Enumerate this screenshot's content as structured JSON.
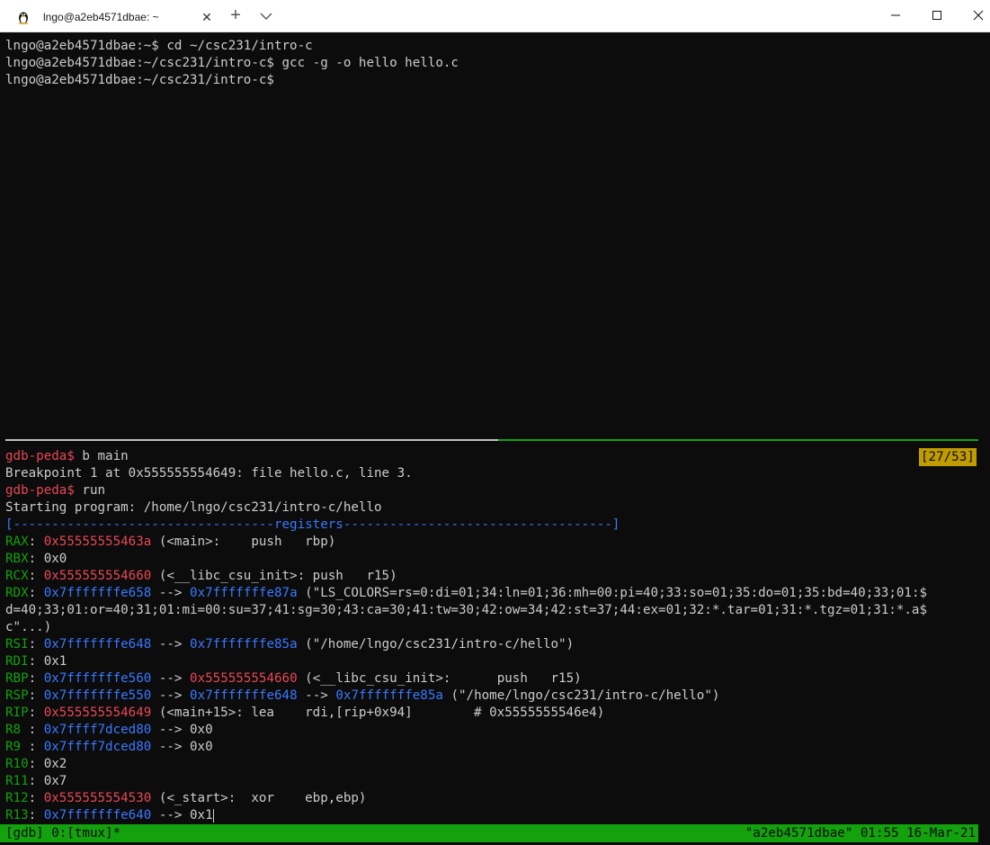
{
  "window": {
    "tab_title": "lngo@a2eb4571dbae: ~",
    "tab_icon": "linux-penguin-icon",
    "new_tab_symbol": "+",
    "close_symbol": "✕",
    "minimize_symbol": "—",
    "maximize_symbol": "☐",
    "window_close_symbol": "✕"
  },
  "top_pane": {
    "lines": [
      "lngo@a2eb4571dbae:~$ cd ~/csc231/intro-c",
      "lngo@a2eb4571dbae:~/csc231/intro-c$ gcc -g -o hello hello.c",
      "lngo@a2eb4571dbae:~/csc231/intro-c$"
    ]
  },
  "bottom_pane": {
    "position_indicator": "[27/53]",
    "prompt": "gdb-peda$",
    "cmd1": " b main",
    "breakpoint_msg": "Breakpoint 1 at 0x555555554649: file hello.c, line 3.",
    "cmd2": " run",
    "starting_msg": "Starting program: /home/lngo/csc231/intro-c/hello",
    "registers_header": "[----------------------------------registers-----------------------------------]",
    "registers": {
      "rax": {
        "name": "RAX",
        "value": "0x55555555463a",
        "rest": " (<main>:    push   rbp)"
      },
      "rbx": {
        "name": "RBX",
        "rest": " 0x0"
      },
      "rcx": {
        "name": "RCX",
        "value": "0x555555554660",
        "rest": " (<__libc_csu_init>: push   r15)"
      },
      "rdx": {
        "name": "RDX",
        "value": "0x7fffffffe658",
        "arrow": " --> ",
        "value2": "0x7fffffffe87a",
        "rest": " (\"LS_COLORS=rs=0:di=01;34:ln=01;36:mh=00:pi=40;33:so=01;35:do=01;35:bd=40;33;01:$",
        "wrap1": "d=40;33;01:or=40;31;01:mi=00:su=37;41:sg=30;43:ca=30;41:tw=30;42:ow=34;42:st=37;44:ex=01;32:*.tar=01;31:*.tgz=01;31:*.a$",
        "wrap2": "c\"...)"
      },
      "rsi": {
        "name": "RSI",
        "value": "0x7fffffffe648",
        "arrow": " --> ",
        "value2": "0x7fffffffe85a",
        "rest": " (\"/home/lngo/csc231/intro-c/hello\")"
      },
      "rdi": {
        "name": "RDI",
        "rest": " 0x1"
      },
      "rbp": {
        "name": "RBP",
        "value": "0x7fffffffe560",
        "arrow": " --> ",
        "value2": "0x555555554660",
        "rest": " (<__libc_csu_init>:      push   r15)"
      },
      "rsp": {
        "name": "RSP",
        "value": "0x7fffffffe550",
        "arrow": " --> ",
        "value2": "0x7fffffffe648",
        "arrow2": " --> ",
        "value3": "0x7fffffffe85a",
        "rest": " (\"/home/lngo/csc231/intro-c/hello\")"
      },
      "rip": {
        "name": "RIP",
        "value": "0x555555554649",
        "rest": " (<main+15>: lea    rdi,[rip+0x94]        # 0x5555555546e4)"
      },
      "r8": {
        "name": "R8 ",
        "value": "0x7ffff7dced80",
        "rest": " --> 0x0"
      },
      "r9": {
        "name": "R9 ",
        "value": "0x7ffff7dced80",
        "rest": " --> 0x0"
      },
      "r10": {
        "name": "R10",
        "rest": " 0x2"
      },
      "r11": {
        "name": "R11",
        "rest": " 0x7"
      },
      "r12": {
        "name": "R12",
        "value": "0x555555554530",
        "rest": " (<_start>:  xor    ebp,ebp)"
      },
      "r13": {
        "name": "R13",
        "value": "0x7fffffffe640",
        "rest": " --> 0x1"
      }
    }
  },
  "status_bar": {
    "left": "[gdb] 0:[tmux]*",
    "right": "\"a2eb4571dbae\" 01:55 16-Mar-21"
  }
}
